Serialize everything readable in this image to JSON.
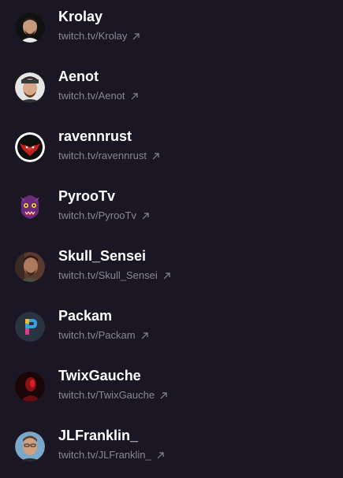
{
  "streamers": [
    {
      "name": "Krolay",
      "link": "twitch.tv/Krolay",
      "avatar_icon": "streamer-avatar-krolay-icon",
      "avatar_bg": "#111111",
      "avatar_fg": "#c79a7c"
    },
    {
      "name": "Aenot",
      "link": "twitch.tv/Aenot",
      "avatar_icon": "streamer-avatar-aenot-icon",
      "avatar_bg": "#e5e5e5",
      "avatar_fg": "#8a6048"
    },
    {
      "name": "ravennrust",
      "link": "twitch.tv/ravennrust",
      "avatar_icon": "raven-logo-icon",
      "avatar_bg": "#c0201c",
      "avatar_fg": "#ffffff"
    },
    {
      "name": "PyrooTv",
      "link": "twitch.tv/PyrooTv",
      "avatar_icon": "purple-monster-icon",
      "avatar_bg": "#1a1624",
      "avatar_fg": "#7a3a8a"
    },
    {
      "name": "Skull_Sensei",
      "link": "twitch.tv/Skull_Sensei",
      "avatar_icon": "streamer-avatar-skull-sensei-icon",
      "avatar_bg": "#5a3a2c",
      "avatar_fg": "#b07a5c"
    },
    {
      "name": "Packam",
      "link": "twitch.tv/Packam",
      "avatar_icon": "packam-logo-icon",
      "avatar_bg": "#2a3440",
      "avatar_fg": "#3aa0e0"
    },
    {
      "name": "TwixGauche",
      "link": "twitch.tv/TwixGauche",
      "avatar_icon": "red-silhouette-icon",
      "avatar_bg": "#1a0606",
      "avatar_fg": "#c01820"
    },
    {
      "name": "JLFranklin_",
      "link": "twitch.tv/JLFranklin_",
      "avatar_icon": "streamer-avatar-jlfranklin-icon",
      "avatar_bg": "#7aa8c8",
      "avatar_fg": "#d0a080"
    }
  ],
  "external_link_icon": "external-link-arrow-icon",
  "colors": {
    "background": "#1a1624",
    "name_text": "#ffffff",
    "link_text": "#8a8795"
  }
}
